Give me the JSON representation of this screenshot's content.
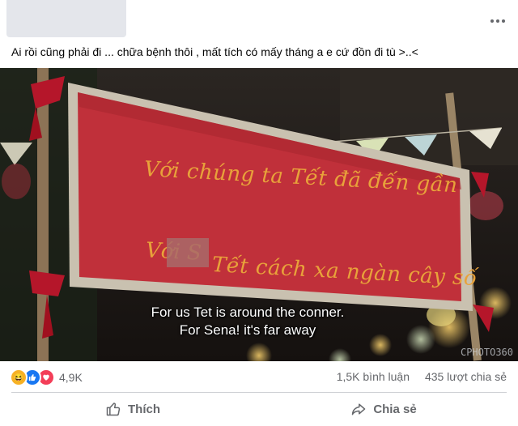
{
  "post": {
    "caption": "Ai rồi cũng phải đi ... chữa bệnh thôi , mất tích có mấy tháng a e cứ đồn đi tù >..<"
  },
  "image": {
    "banner_line1": "Với chúng ta Tết đã đến gần",
    "banner_line2_start": "Với S",
    "banner_line3": "Tết cách xa ngàn cây số",
    "subtitle_line1": "For us Tet is around the conner.",
    "subtitle_line2": "For Sena! it's far away",
    "watermark": "CPHOTO360"
  },
  "stats": {
    "reactions_count": "4,9K",
    "comments": "1,5K bình luận",
    "shares": "435 lượt chia sẻ"
  },
  "actions": {
    "like_label": "Thích",
    "share_label": "Chia sẻ"
  },
  "icons": {
    "more": "more-dots-icon",
    "haha": "haha-reaction-icon",
    "like_reaction": "like-reaction-icon",
    "love": "love-reaction-icon",
    "like": "thumbs-up-icon",
    "share": "share-arrow-icon"
  },
  "colors": {
    "banner_red": "#c0303a",
    "banner_text": "#e8a23a",
    "meta_text": "#65676b",
    "like_blue": "#1877f2",
    "love_red": "#f33e58",
    "haha_yellow": "#f7b125"
  }
}
